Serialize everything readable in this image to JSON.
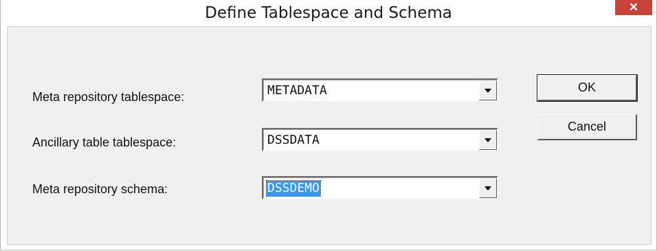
{
  "window": {
    "title": "Define Tablespace and Schema",
    "close_glyph": "✕"
  },
  "form": {
    "fields": [
      {
        "label": "Meta repository tablespace:",
        "value": "METADATA",
        "selected": false
      },
      {
        "label": "Ancillary table tablespace:",
        "value": "DSSDATA",
        "selected": false
      },
      {
        "label": "Meta repository schema:",
        "value": "DSSDEMO",
        "selected": true
      }
    ]
  },
  "buttons": {
    "ok_label": "OK",
    "cancel_label": "Cancel"
  },
  "colors": {
    "close_button": "#c7433a",
    "selection_highlight": "#3399ff",
    "dialog_face": "#f0f0f0"
  },
  "icons": {
    "close": "close-icon",
    "dropdown": "chevron-down-icon"
  }
}
